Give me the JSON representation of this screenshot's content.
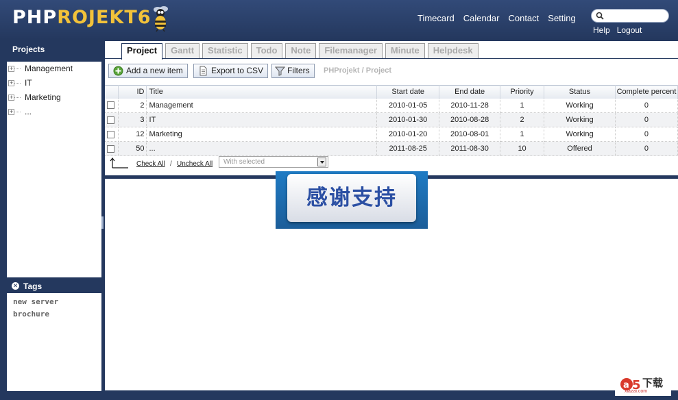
{
  "app": {
    "logo_php": "PHP",
    "logo_projekt": "ROJEKT6"
  },
  "header": {
    "nav": [
      "Timecard",
      "Calendar",
      "Contact",
      "Setting"
    ],
    "search": {
      "value": "",
      "placeholder": ""
    },
    "subnav": [
      "Help",
      "Logout"
    ]
  },
  "sidebar": {
    "title": "Projects",
    "items": [
      {
        "label": "Management"
      },
      {
        "label": "IT"
      },
      {
        "label": "Marketing"
      },
      {
        "label": "..."
      }
    ],
    "tags_title": "Tags",
    "tags": [
      "new server",
      "brochure"
    ]
  },
  "tabs": [
    {
      "label": "Project",
      "active": true
    },
    {
      "label": "Gantt"
    },
    {
      "label": "Statistic"
    },
    {
      "label": "Todo"
    },
    {
      "label": "Note"
    },
    {
      "label": "Filemanager"
    },
    {
      "label": "Minute"
    },
    {
      "label": "Helpdesk"
    }
  ],
  "toolbar": {
    "add_label": "Add a new item",
    "export_label": "Export to CSV",
    "filters_label": "Filters",
    "breadcrumb": "PHProjekt / Project"
  },
  "grid": {
    "columns": [
      "ID",
      "Title",
      "Start date",
      "End date",
      "Priority",
      "Status",
      "Complete percent"
    ],
    "rows": [
      {
        "id": "2",
        "title": "Management",
        "start": "2010-01-05",
        "end": "2010-11-28",
        "priority": "1",
        "status": "Working",
        "complete": "0"
      },
      {
        "id": "3",
        "title": "IT",
        "start": "2010-01-30",
        "end": "2010-08-28",
        "priority": "2",
        "status": "Working",
        "complete": "0"
      },
      {
        "id": "12",
        "title": "Marketing",
        "start": "2010-01-20",
        "end": "2010-08-01",
        "priority": "1",
        "status": "Working",
        "complete": "0"
      },
      {
        "id": "50",
        "title": "...",
        "start": "2011-08-25",
        "end": "2011-08-30",
        "priority": "10",
        "status": "Offered",
        "complete": "0"
      }
    ],
    "check_all": "Check All",
    "separator": "/",
    "uncheck_all": "Uncheck All",
    "with_selected": "With selected"
  },
  "overlay": {
    "text": "感谢支持"
  },
  "watermark": {
    "text": "下载",
    "sub": "xiazai.com"
  },
  "colors": {
    "header_bg": "#24385e",
    "logo_accent": "#f2c23a",
    "overlay_blue": "#1f7bc4"
  }
}
